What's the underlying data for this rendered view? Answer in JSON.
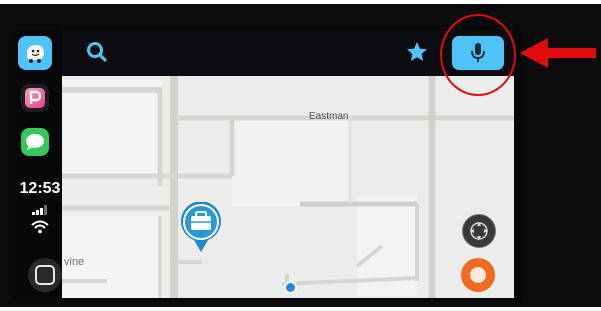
{
  "status": {
    "time": "12:53"
  },
  "map": {
    "streets": [
      "Eastman",
      "vine"
    ]
  },
  "dock": {
    "apps": [
      "waze-icon",
      "parking-app-icon",
      "messages-icon"
    ]
  },
  "toolbar": {
    "search_icon": "search-icon",
    "favorites_icon": "star-icon",
    "voice_icon": "microphone-icon"
  },
  "colors": {
    "accent": "#4fc3f7",
    "annotation": "#e30c0c",
    "report": "#f06a1f",
    "location": "#1e88e5"
  }
}
